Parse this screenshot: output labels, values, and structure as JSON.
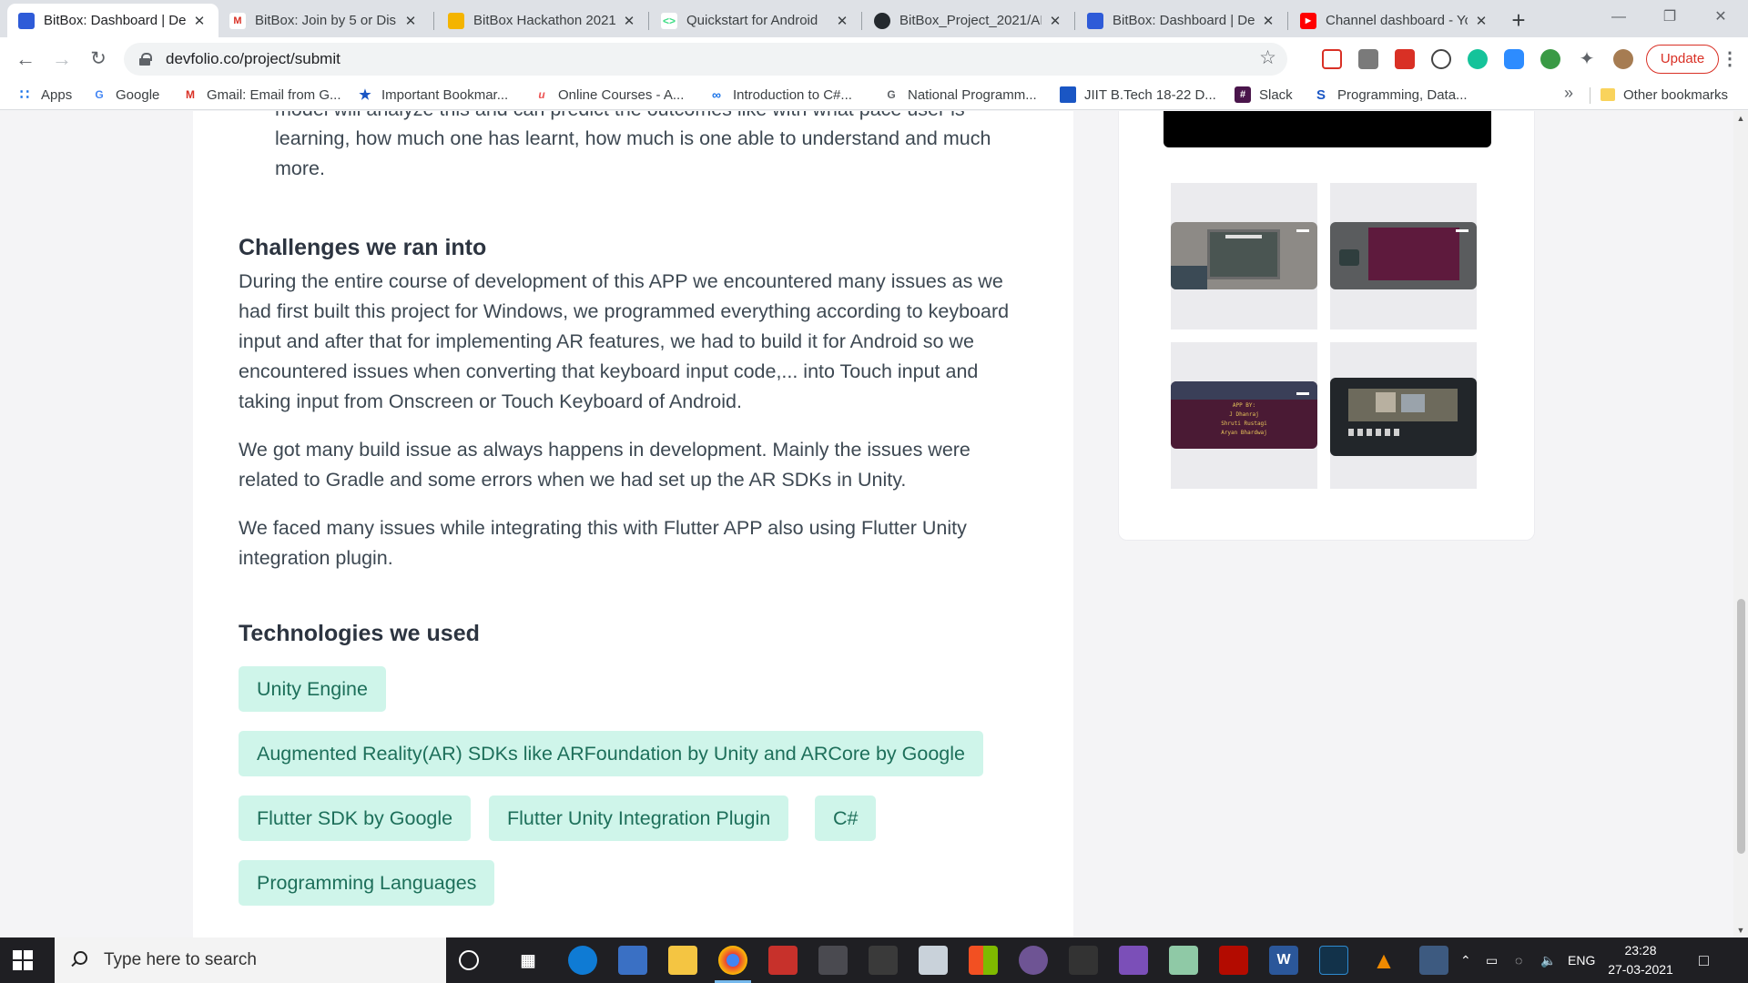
{
  "browser": {
    "tabs": [
      {
        "title": "BitBox: Dashboard | De",
        "favicon": "devfolio-icon",
        "active": true
      },
      {
        "title": "BitBox: Join by 5 or Dis",
        "favicon": "gmail-icon",
        "active": false
      },
      {
        "title": "BitBox Hackathon 2021",
        "favicon": "slides-icon",
        "active": false
      },
      {
        "title": "Quickstart for Android",
        "favicon": "android-dev-icon",
        "active": false
      },
      {
        "title": "BitBox_Project_2021/AI",
        "favicon": "github-icon",
        "active": false
      },
      {
        "title": "BitBox: Dashboard | De",
        "favicon": "devfolio-icon",
        "active": false
      },
      {
        "title": "Channel dashboard - Yo",
        "favicon": "youtube-icon",
        "active": false
      }
    ],
    "url": "devfolio.co/project/submit",
    "update_label": "Update",
    "bookmarks": [
      {
        "label": "Apps",
        "icon": "apps-grid-icon"
      },
      {
        "label": "Google",
        "icon": "google-icon"
      },
      {
        "label": "Gmail: Email from G...",
        "icon": "gmail-icon"
      },
      {
        "label": "Important Bookmar...",
        "icon": "star-bookmark-icon"
      },
      {
        "label": "Online Courses - A...",
        "icon": "udemy-icon"
      },
      {
        "label": "Introduction to C#...",
        "icon": "link-icon"
      },
      {
        "label": "National Programm...",
        "icon": "google-icon"
      },
      {
        "label": "JIIT B.Tech 18-22 D...",
        "icon": "classroom-icon"
      },
      {
        "label": "Slack",
        "icon": "slack-icon"
      },
      {
        "label": "Programming, Data...",
        "icon": "s-icon"
      }
    ],
    "other_bookmarks": "Other bookmarks"
  },
  "page": {
    "clipped_line": "model will analyze this and can predict the outcomes like with what pace user is",
    "bullet_continuation": "learning, how much one has learnt, how much is one able to understand and much more.",
    "challenges_heading": "Challenges we ran into",
    "challenges_p1": "During the entire course of development of this APP we encountered many issues as we had first built this project for Windows, we programmed everything according to keyboard input and after that for implementing AR features, we had to build it for Android so we encountered issues when converting that keyboard input code,... into Touch input and taking input from Onscreen or Touch Keyboard of Android.",
    "challenges_p2": "We got many build issue as always happens in development. Mainly the issues were related to Gradle and some errors when we had set up the AR SDKs in Unity.",
    "challenges_p3": "We faced many issues while integrating this with Flutter APP also using Flutter Unity integration plugin.",
    "tech_heading": "Technologies we used",
    "technologies": [
      "Unity Engine",
      "Augmented Reality(AR) SDKs like ARFoundation by Unity and ARCore by Google",
      "Flutter SDK by Google",
      "Flutter Unity Integration Plugin",
      "C#",
      "Programming Languages"
    ],
    "thumb3_lines": [
      "APP BY:",
      "J Dhanraj",
      "Shruti Rustagi",
      "Aryan Bhardwaj"
    ]
  },
  "taskbar": {
    "search_placeholder": "Type here to search",
    "language": "ENG",
    "time": "23:28",
    "date": "27-03-2021"
  },
  "colors": {
    "chip_bg": "#cff5ea",
    "chip_text": "#1d6f5a",
    "update_red": "#d93025"
  }
}
